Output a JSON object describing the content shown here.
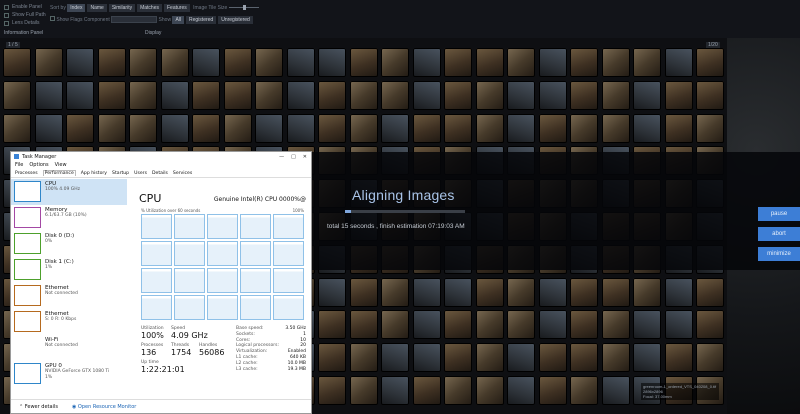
{
  "app": {
    "panel_options": [
      "Enable Panel",
      "Show Full Path",
      "Lens Details"
    ],
    "show_flags": "Show Flags",
    "info_panel": "Information Panel",
    "display": "Display",
    "sort_by": "Sort by",
    "sort_options": [
      "Index",
      "Name",
      "Similarity",
      "Matches",
      "Features"
    ],
    "image_tile_size": "Image Tile Size",
    "component": "Component",
    "show": "Show",
    "show_options": [
      "All",
      "Registered",
      "Unregistered"
    ]
  },
  "grid": {
    "left_badge": "1 / 5",
    "right_badge": "1/20"
  },
  "preview": {
    "info_lines": [
      "greenroom-1_ordered_VTS_040208_0.tif",
      "2896x2896",
      "Focal: 37.00mm"
    ]
  },
  "alignment": {
    "title": "Aligning Images",
    "progress": 0.05,
    "status": "total 15 seconds , finish estimation 07:19:03 AM",
    "buttons": [
      "pause",
      "abort",
      "minimize"
    ]
  },
  "taskmanager": {
    "title": "Task Manager",
    "menu": [
      "File",
      "Options",
      "View"
    ],
    "tabs": [
      "Processes",
      "Performance",
      "App history",
      "Startup",
      "Users",
      "Details",
      "Services"
    ],
    "active_tab": "Performance",
    "resources": [
      {
        "name": "CPU",
        "detail": "100% 4.09 GHz",
        "kind": "cpu"
      },
      {
        "name": "Memory",
        "detail": "6.1/63.7 GB (10%)",
        "kind": "mem"
      },
      {
        "name": "Disk 0 (D:)",
        "detail": "0%",
        "kind": "disk"
      },
      {
        "name": "Disk 1 (C:)",
        "detail": "1%",
        "kind": "disk"
      },
      {
        "name": "Ethernet",
        "detail": "Not connected",
        "kind": "eth"
      },
      {
        "name": "Ethernet",
        "detail": "S: 0 R: 0 Kbps",
        "kind": "eth"
      },
      {
        "name": "Wi-Fi",
        "detail": "Not connected",
        "kind": "none"
      },
      {
        "name": "GPU 0",
        "detail": "NVIDIA GeForce GTX 1080 Ti",
        "detail2": "1%",
        "kind": "gpu"
      }
    ],
    "main": {
      "heading": "CPU",
      "cpu_name": "Genuine Intel(R) CPU 0000%@",
      "graph_label_left": "% Utilization over 60 seconds",
      "graph_label_right": "100%",
      "core_count": 20,
      "stats": {
        "utilization_label": "Utilization",
        "utilization": "100%",
        "speed_label": "Speed",
        "speed": "4.09 GHz",
        "processes_label": "Processes",
        "processes": "136",
        "threads_label": "Threads",
        "threads": "1754",
        "handles_label": "Handles",
        "handles": "56086",
        "uptime_label": "Up time",
        "uptime": "1:22:21:01"
      },
      "specs": [
        {
          "label": "Base speed:",
          "value": "3.50 GHz"
        },
        {
          "label": "Sockets:",
          "value": "1"
        },
        {
          "label": "Cores:",
          "value": "10"
        },
        {
          "label": "Logical processors:",
          "value": "20"
        },
        {
          "label": "Virtualization:",
          "value": "Enabled"
        },
        {
          "label": "L1 cache:",
          "value": "640 KB"
        },
        {
          "label": "L2 cache:",
          "value": "10.0 MB"
        },
        {
          "label": "L3 cache:",
          "value": "19.3 MB"
        }
      ]
    },
    "footer": {
      "fewer_details": "Fewer details",
      "open_monitor": "Open Resource Monitor"
    }
  }
}
